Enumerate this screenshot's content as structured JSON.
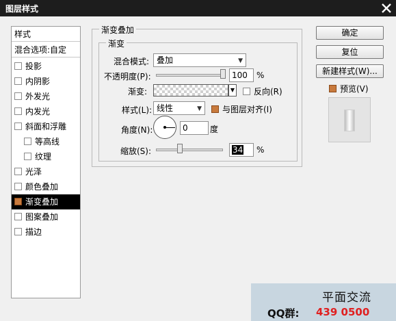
{
  "window": {
    "title": "图层样式"
  },
  "sidebar": {
    "header": "样式",
    "blend": "混合选项:自定",
    "items": [
      {
        "label": "投影",
        "checked": false
      },
      {
        "label": "内阴影",
        "checked": false
      },
      {
        "label": "外发光",
        "checked": false
      },
      {
        "label": "内发光",
        "checked": false
      },
      {
        "label": "斜面和浮雕",
        "checked": false
      },
      {
        "label": "等高线",
        "checked": false
      },
      {
        "label": "纹理",
        "checked": false
      },
      {
        "label": "光泽",
        "checked": false
      },
      {
        "label": "颜色叠加",
        "checked": false
      },
      {
        "label": "渐变叠加",
        "checked": true
      },
      {
        "label": "图案叠加",
        "checked": false
      },
      {
        "label": "描边",
        "checked": false
      }
    ]
  },
  "overlay": {
    "group_title": "渐变叠加",
    "subgroup_title": "渐变",
    "blend_mode_label": "混合模式:",
    "blend_mode_value": "叠加",
    "opacity_label": "不透明度(P):",
    "opacity_value": "100",
    "opacity_unit": "%",
    "opacity_level": 1.0,
    "gradient_label": "渐变:",
    "reverse_label": "反向(R)",
    "reverse_checked": false,
    "style_label": "样式(L):",
    "style_value": "线性",
    "align_label": "与图层对齐(I)",
    "align_checked": true,
    "angle_label": "角度(N):",
    "angle_value": "0",
    "angle_unit": "度",
    "scale_label": "缩放(S):",
    "scale_value": "34",
    "scale_unit": "%",
    "scale_level": 0.34
  },
  "buttons": {
    "ok": "确定",
    "reset": "复位",
    "new_style": "新建样式(W)...",
    "preview_label": "预览(V)",
    "preview_checked": true
  },
  "watermark": {
    "title": "平面交流",
    "qq_label": "QQ群:",
    "qq_number": "439 0500"
  },
  "colors": {
    "titlebar": "#1d1d1d",
    "accent_checkbox": "#c87a3d",
    "active_row": "#000000"
  }
}
